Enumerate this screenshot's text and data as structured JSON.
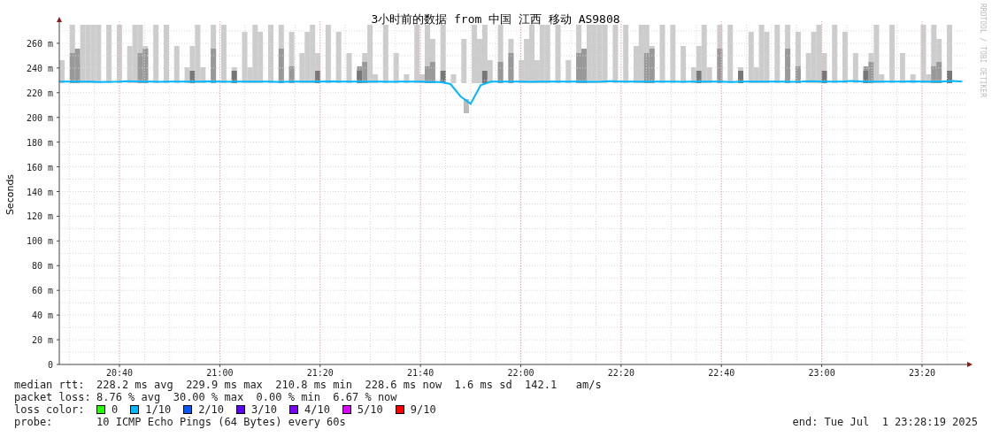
{
  "graph": {
    "credit": "RRDTOOL / TOBI OETIKER",
    "chart_data": {
      "type": "line",
      "title": "3小时前的数据 from 中国 江西 移动 AS9808",
      "ylabel": "Seconds",
      "categories": [
        null,
        null,
        null,
        null,
        null,
        null,
        "20:40",
        null,
        null,
        null,
        null,
        null,
        null,
        null,
        null,
        null,
        "21:00",
        null,
        null,
        null,
        null,
        null,
        null,
        null,
        null,
        null,
        "21:20",
        null,
        null,
        null,
        null,
        null,
        null,
        null,
        null,
        null,
        "21:40",
        null,
        null,
        null,
        null,
        null,
        null,
        null,
        null,
        null,
        "22:00",
        null,
        null,
        null,
        null,
        null,
        null,
        null,
        null,
        null,
        "22:20",
        null,
        null,
        null,
        null,
        null,
        null,
        null,
        null,
        null,
        "22:40",
        null,
        null,
        null,
        null,
        null,
        null,
        null,
        null,
        null,
        "23:00",
        null,
        null,
        null,
        null,
        null,
        null,
        null,
        null,
        null,
        "23:20",
        null,
        null,
        null,
        null
      ],
      "series": [
        {
          "color": "#00b8ff",
          "values": [
            229,
            229,
            229,
            229,
            228.6,
            228.8,
            229,
            229.4,
            229,
            229,
            228.8,
            229,
            229,
            229,
            229,
            229.2,
            229,
            228.8,
            229,
            229,
            229,
            229,
            228.6,
            229,
            229,
            229,
            229,
            229.2,
            229,
            229,
            229,
            229,
            229,
            228.8,
            229,
            229,
            229,
            228.6,
            228.6,
            227,
            217,
            211,
            226,
            229,
            229,
            229,
            229,
            228.8,
            229,
            229,
            229,
            229,
            229,
            228.8,
            229,
            229.4,
            229,
            229,
            229,
            229,
            229,
            229,
            228.8,
            229,
            229,
            229,
            229,
            228.6,
            229,
            229,
            229,
            229,
            229,
            228.8,
            229,
            229.4,
            229,
            229,
            229,
            229.6,
            229,
            229,
            229,
            229,
            229,
            229.2,
            229,
            229,
            229,
            229.6,
            229
          ]
        }
      ],
      "ylim": [
        0,
        275
      ],
      "grid": true,
      "yticks": [
        {
          "value": 0,
          "label": "0"
        },
        {
          "value": 20,
          "label": "20 m"
        },
        {
          "value": 40,
          "label": "40 m"
        },
        {
          "value": 60,
          "label": "60 m"
        },
        {
          "value": 80,
          "label": "80 m"
        },
        {
          "value": 100,
          "label": "100 m"
        },
        {
          "value": 120,
          "label": "120 m"
        },
        {
          "value": 140,
          "label": "140 m"
        },
        {
          "value": 160,
          "label": "160 m"
        },
        {
          "value": 180,
          "label": "180 m"
        },
        {
          "value": 200,
          "label": "200 m"
        },
        {
          "value": 220,
          "label": "220 m"
        },
        {
          "value": 240,
          "label": "240 m"
        },
        {
          "value": 260,
          "label": "260 m"
        }
      ]
    }
  },
  "legend": {
    "stats": [
      {
        "label": "median rtt:",
        "value": "228.2 ms avg  229.9 ms max  210.8 ms min  228.6 ms now  1.6 ms sd  142.1   am/s"
      },
      {
        "label": "packet loss:",
        "value": "8.76 % avg  30.00 % max  0.00 % min  6.67 % now"
      }
    ],
    "loss_color": {
      "label": "loss color:",
      "items": [
        {
          "label": "0",
          "color": "#26ff00"
        },
        {
          "label": "1/10",
          "color": "#00b8ff"
        },
        {
          "label": "2/10",
          "color": "#0059ff"
        },
        {
          "label": "3/10",
          "color": "#5e00ff"
        },
        {
          "label": "4/10",
          "color": "#7e00ff"
        },
        {
          "label": "5/10",
          "color": "#dd00ff"
        },
        {
          "label": "9/10",
          "color": "#ff0000"
        }
      ]
    },
    "probe": {
      "label": "probe:",
      "value": "10 ICMP Echo Pings (64 Bytes) every 60s"
    },
    "end": "end: Tue Jul  1 23:28:19 2025"
  }
}
